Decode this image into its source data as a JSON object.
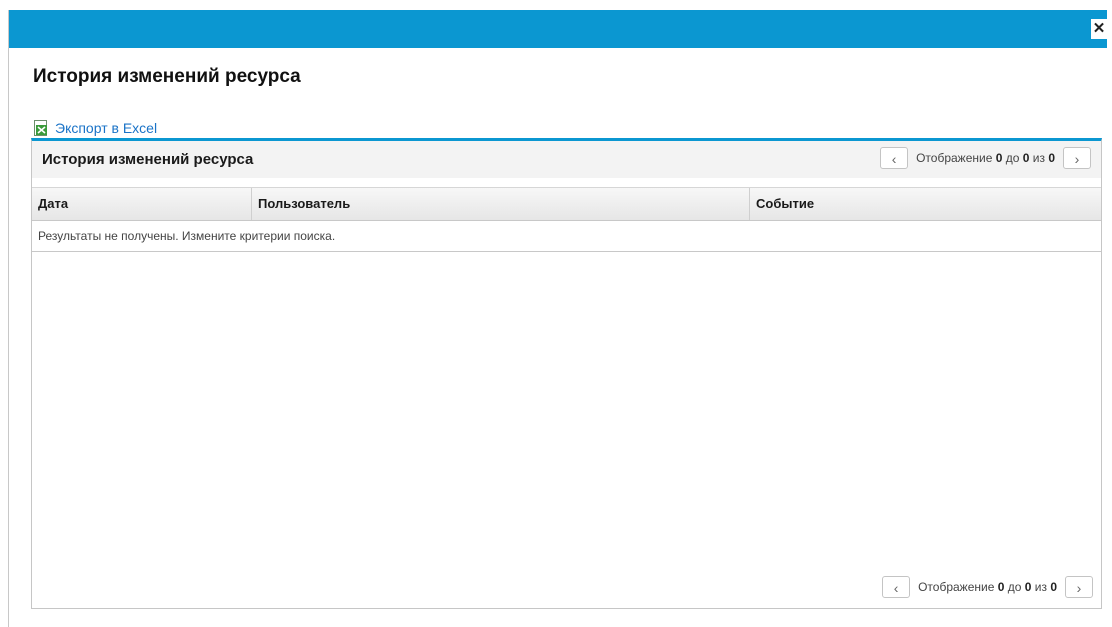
{
  "dialog": {
    "close_label": "✕",
    "title": "История изменений ресурса",
    "export_label": "Экспорт в Excel"
  },
  "panel": {
    "title": "История изменений ресурса",
    "pager": {
      "prefix": "Отображение ",
      "from": "0",
      "middle": " до ",
      "to": "0",
      "of": " из ",
      "total": "0",
      "prev_icon": "‹",
      "next_icon": "›"
    },
    "columns": [
      "Дата",
      "Пользователь",
      "Событие"
    ],
    "empty_message": "Результаты не получены. Измените критерии поиска."
  },
  "colors": {
    "titlebar": "#0b97d1",
    "link": "#1a73c7",
    "excel_green": "#3a9b3a"
  },
  "icons": {
    "close": "close-icon",
    "export": "excel-icon",
    "prev": "chevron-left-icon",
    "next": "chevron-right-icon"
  }
}
